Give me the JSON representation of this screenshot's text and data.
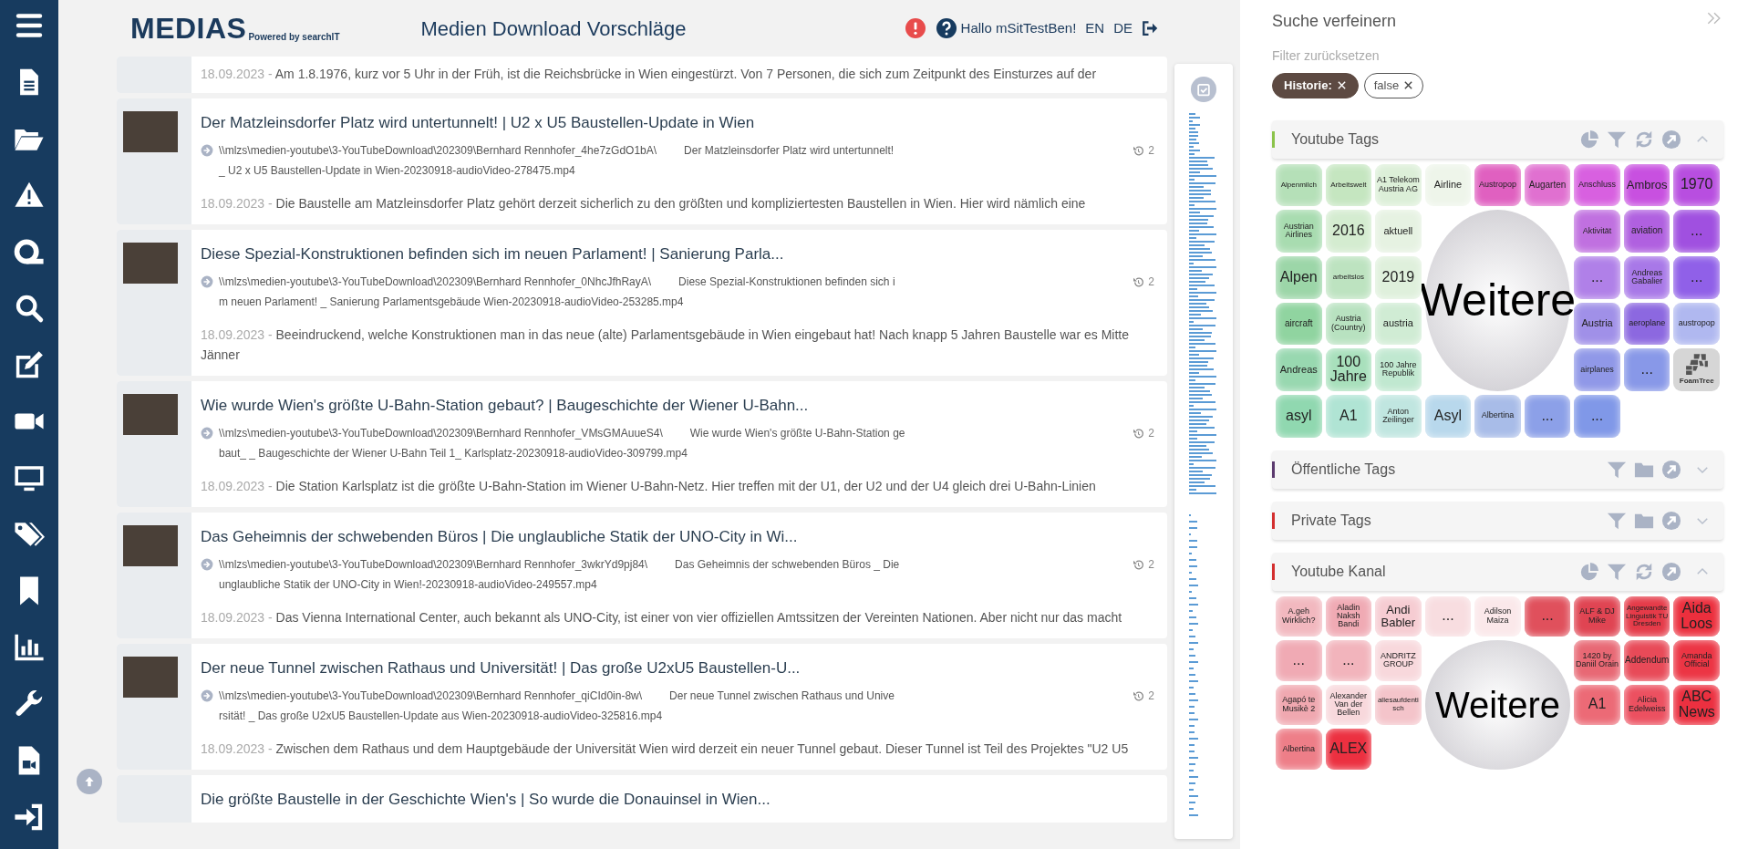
{
  "app": {
    "logo": "MEDIAS",
    "logo_sub": "Powered by searchIT",
    "title": "Medien Download Vorschläge",
    "greeting": "Hallo mSitTestBen!",
    "languages": [
      "EN",
      "DE"
    ]
  },
  "results": [
    {
      "date": "18.09.2023 -",
      "description": "Am 1.8.1976, kurz vor 5 Uhr in der Früh, ist die Reichsbrücke in Wien eingestürzt. Von 7 Personen, die sich zum Zeitpunkt des Einsturzes auf der"
    },
    {
      "title": "Der Matzleinsdorfer Platz wird untertunnelt! | U2 x U5 Baustellen-Update in Wien",
      "path": "\\\\mlzs\\medien-youtube\\3-YouTubeDownload\\202309\\Bernhard Rennhofer_4he7zGdO1bA\\",
      "file_start": "Der Matzleinsdorfer Platz wird untertunnelt!",
      "file_end": "_ U2 x U5 Baustellen-Update in Wien-20230918-audioVideo-278475.mp4",
      "views": "2",
      "date": "18.09.2023 -",
      "description": "Die Baustelle am Matzleinsdorfer Platz gehört derzeit sicherlich zu den größten und kompliziertesten Baustellen in Wien. Hier wird nämlich eine"
    },
    {
      "title": "Diese Spezial-Konstruktionen befinden sich im neuen Parlament! | Sanierung Parla...",
      "path": "\\\\mlzs\\medien-youtube\\3-YouTubeDownload\\202309\\Bernhard Rennhofer_0NhcJfhRayA\\",
      "file_start": "Diese Spezial-Konstruktionen befinden sich i",
      "file_end": "m neuen Parlament! _ Sanierung Parlamentsgebäude Wien-20230918-audioVideo-253285.mp4",
      "views": "2",
      "date": "18.09.2023 -",
      "description": "Beeindruckend, welche Konstruktionen man in das neue (alte) Parlamentsgebäude in Wien eingebaut hat! Nach knapp 5 Jahren Baustelle war es Mitte Jänner"
    },
    {
      "title": "Wie wurde Wien's größte U-Bahn-Station gebaut? | Baugeschichte der Wiener U-Bahn...",
      "path": "\\\\mlzs\\medien-youtube\\3-YouTubeDownload\\202309\\Bernhard Rennhofer_VMsGMAuueS4\\",
      "file_start": "Wie wurde Wien's größte U-Bahn-Station ge",
      "file_end": "baut_ _ Baugeschichte der Wiener U-Bahn Teil 1_ Karlsplatz-20230918-audioVideo-309799.mp4",
      "views": "2",
      "date": "18.09.2023 -",
      "description": "Die Station Karlsplatz ist die größte U-Bahn-Station im Wiener U-Bahn-Netz. Hier treffen mit der U1, der U2 und der U4 gleich drei U-Bahn-Linien"
    },
    {
      "title": "Das Geheimnis der schwebenden Büros | Die unglaubliche Statik der UNO-City in Wi...",
      "path": "\\\\mlzs\\medien-youtube\\3-YouTubeDownload\\202309\\Bernhard Rennhofer_3wkrYd9pj84\\",
      "file_start": "Das Geheimnis der schwebenden Büros _ Die",
      "file_end": "unglaubliche Statik der UNO-City in Wien!-20230918-audioVideo-249557.mp4",
      "views": "2",
      "date": "18.09.2023 -",
      "description": "Das Vienna International Center, auch bekannt als UNO-City, ist einer von vier offiziellen Amtssitzen der Vereinten Nationen. Aber nicht nur das macht"
    },
    {
      "title": "Der neue Tunnel zwischen Rathaus und Universität! | Das große U2xU5 Baustellen-U...",
      "path": "\\\\mlzs\\medien-youtube\\3-YouTubeDownload\\202309\\Bernhard Rennhofer_qiCId0in-8w\\",
      "file_start": "Der neue Tunnel zwischen Rathaus und Unive",
      "file_end": "rsität! _ Das große U2xU5 Baustellen-Update aus Wien-20230918-audioVideo-325816.mp4",
      "views": "2",
      "date": "18.09.2023 -",
      "description": "Zwischen dem Rathaus und dem Hauptgebäude der Universität Wien wird derzeit ein neuer Tunnel gebaut. Dieser Tunnel ist Teil des Projektes \"U2 U5"
    },
    {
      "title": "Die größte Baustelle in der Geschichte Wien's | So wurde die Donauinsel in Wien..."
    }
  ],
  "refine": {
    "title": "Suche verfeinern",
    "reset": "Filter zurücksetzen",
    "chips": [
      {
        "label": "Historie:",
        "kind": "key"
      },
      {
        "label": "false",
        "kind": "value"
      }
    ],
    "sections": [
      {
        "title": "Youtube Tags",
        "color": "#8bc34a",
        "kind": "chart",
        "expanded": true,
        "center": "Weitere",
        "cells": [
          {
            "label": "Alpenmilch",
            "kind": "tag",
            "color": "#b5e0b8"
          },
          {
            "label": "Arbeitswelt",
            "kind": "tag",
            "color": "#c5e6c0"
          },
          {
            "label": "A1 Telekom Austria AG",
            "kind": "tag",
            "color": "#dcefd8"
          },
          {
            "label": "Airline",
            "kind": "tag",
            "color": "#eef5ea"
          },
          {
            "label": "Austropop",
            "kind": "tag",
            "color": "#e060c0"
          },
          {
            "label": "Augarten",
            "kind": "tag",
            "color": "#e070d0"
          },
          {
            "label": "Anschluss",
            "kind": "tag",
            "color": "#d860e0"
          },
          {
            "label": "Ambros",
            "kind": "tag",
            "color": "#c850e0"
          },
          {
            "label": "1970",
            "kind": "tag",
            "color": "#b84ee0"
          },
          {
            "label": "Austrian Airlines",
            "kind": "tag",
            "color": "#a8dcb0"
          },
          {
            "label": "2016",
            "kind": "tag",
            "color": "#d4ecd0"
          },
          {
            "label": "aktuell",
            "kind": "tag",
            "color": "#e6f2e2"
          },
          {
            "label": "Aktivität",
            "kind": "tag",
            "color": "#c070e0"
          },
          {
            "label": "aviation",
            "kind": "tag",
            "color": "#b060e0"
          },
          {
            "label": "...",
            "kind": "tag",
            "color": "#a050e0"
          },
          {
            "label": "Alpen",
            "kind": "tag",
            "color": "#9cd6a8"
          },
          {
            "label": "arbeitslos",
            "kind": "tag",
            "color": "#bde3c0"
          },
          {
            "label": "2019",
            "kind": "tag",
            "color": "#dff0dc"
          },
          {
            "label": "...",
            "kind": "tag",
            "color": "#b080e8"
          },
          {
            "label": "Andreas Gabalier",
            "kind": "tag",
            "color": "#a878e8"
          },
          {
            "label": "...",
            "kind": "tag",
            "color": "#9060e8"
          },
          {
            "label": "aircraft",
            "kind": "tag",
            "color": "#90d4a0"
          },
          {
            "label": "Austria (Country)",
            "kind": "tag",
            "color": "#b8e2c0"
          },
          {
            "label": "austria",
            "kind": "tag",
            "color": "#d0ecd4"
          },
          {
            "label": "Austria",
            "kind": "tag",
            "color": "#a090e8"
          },
          {
            "label": "aeroplane",
            "kind": "tag",
            "color": "#8c68e0"
          },
          {
            "label": "austropop",
            "kind": "tag",
            "color": "#b0b8f0"
          },
          {
            "label": "Andreas",
            "kind": "tag",
            "color": "#98d8b0"
          },
          {
            "label": "100 Jahre",
            "kind": "tag",
            "color": "#a8e0bc"
          },
          {
            "label": "100 Jahre Republik",
            "kind": "tag",
            "color": "#c0e8d0"
          },
          {
            "label": "airplanes",
            "kind": "tag",
            "color": "#9098e8"
          },
          {
            "label": "...",
            "kind": "tag",
            "color": "#8898e8"
          },
          {
            "label": "FoamTree",
            "kind": "logo",
            "color": "#d6d6d6"
          },
          {
            "label": "asyl",
            "kind": "tag",
            "color": "#90d8b0"
          },
          {
            "label": "A1",
            "kind": "tag",
            "color": "#b0e4d4"
          },
          {
            "label": "Anton Zeilinger",
            "kind": "tag",
            "color": "#c0e6e0"
          },
          {
            "label": "Asyl",
            "kind": "tag",
            "color": "#b8d8ec"
          },
          {
            "label": "Albertina",
            "kind": "tag",
            "color": "#a8bce8"
          },
          {
            "label": "...",
            "kind": "tag",
            "color": "#8ca0e8"
          },
          {
            "label": "...",
            "kind": "tag",
            "color": "#8098e8"
          }
        ]
      },
      {
        "title": "Öffentliche Tags",
        "color": "#5b3a6e",
        "kind": "list",
        "expanded": false
      },
      {
        "title": "Private Tags",
        "color": "#d32f2f",
        "kind": "list",
        "expanded": false
      },
      {
        "title": "Youtube Kanal",
        "color": "#d32f2f",
        "kind": "chart",
        "expanded": true,
        "center": "Weitere",
        "cells": [
          {
            "label": "A.geh Wirklich?",
            "kind": "tag",
            "color": "#f2b8bf"
          },
          {
            "label": "Aladin Naksh Bandi",
            "kind": "tag",
            "color": "#f0aab4"
          },
          {
            "label": "Andi Babler",
            "kind": "tag",
            "color": "#f6ccd2"
          },
          {
            "label": "...",
            "kind": "tag",
            "color": "#f8dde0"
          },
          {
            "label": "Adilson Maiza",
            "kind": "tag",
            "color": "#fbe8ea"
          },
          {
            "label": "...",
            "kind": "tag",
            "color": "#e0505c"
          },
          {
            "label": "ALF & DJ Mike",
            "kind": "tag",
            "color": "#e04452"
          },
          {
            "label": "Angewandte Linguistik TU Dresden",
            "kind": "tag",
            "color": "#e53a48"
          },
          {
            "label": "Aida Loos",
            "kind": "tag",
            "color": "#ec2f3d"
          },
          {
            "label": "...",
            "kind": "tag",
            "color": "#f0aab4"
          },
          {
            "label": "...",
            "kind": "tag",
            "color": "#f2b4bc"
          },
          {
            "label": "ANDRITZ GROUP",
            "kind": "tag",
            "color": "#f8d8dc"
          },
          {
            "label": "1420 by Daniil Orain",
            "kind": "tag",
            "color": "#e86874"
          },
          {
            "label": "Addendum",
            "kind": "tag",
            "color": "#e84a58"
          },
          {
            "label": "Amanda Official",
            "kind": "tag",
            "color": "#ec3544"
          },
          {
            "label": "Agapó te Musikè 2",
            "kind": "tag",
            "color": "#f0a8b0"
          },
          {
            "label": "Alexander Van der Bellen",
            "kind": "tag",
            "color": "#f8d8dc"
          },
          {
            "label": "allesaufdentisch",
            "kind": "tag",
            "color": "#f4c4ca"
          },
          {
            "label": "A1",
            "kind": "tag",
            "color": "#ec6a76"
          },
          {
            "label": "Alicia Edelweiss",
            "kind": "tag",
            "color": "#ec5060"
          },
          {
            "label": "ABC News",
            "kind": "tag",
            "color": "#ec3040"
          },
          {
            "label": "Albertina",
            "kind": "tag",
            "color": "#ee7e88"
          },
          {
            "label": "ALEX",
            "kind": "tag",
            "color": "#ec3040"
          }
        ]
      }
    ]
  }
}
